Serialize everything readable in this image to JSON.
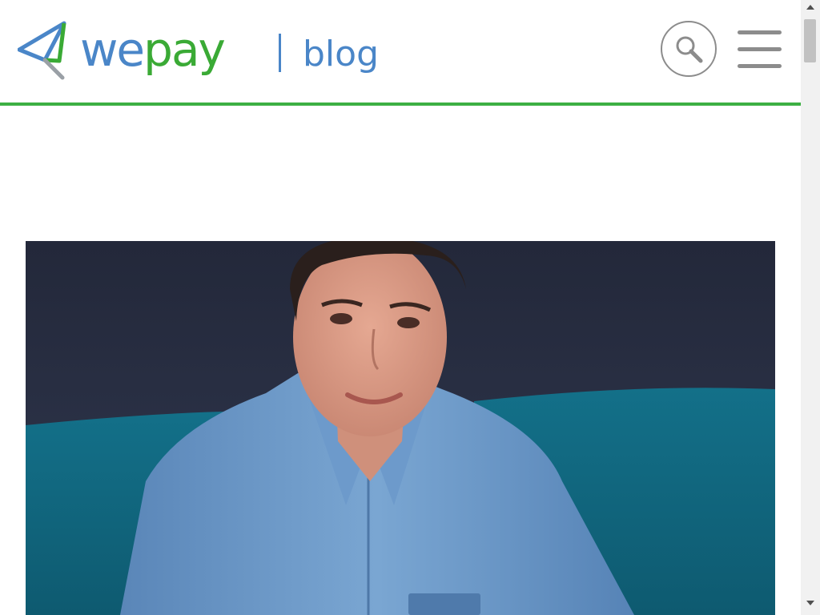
{
  "header": {
    "logo": {
      "word_part1": "we",
      "word_part2": "pay"
    },
    "section_label": "blog",
    "search_icon": "search-icon",
    "menu_icon": "hamburger-menu-icon"
  },
  "colors": {
    "brand_blue": "#4a86c8",
    "brand_green": "#3aaa35",
    "header_rule": "#3cb043",
    "icon_gray": "#8c8c8c"
  },
  "hero": {
    "image": "portrait-photo"
  }
}
